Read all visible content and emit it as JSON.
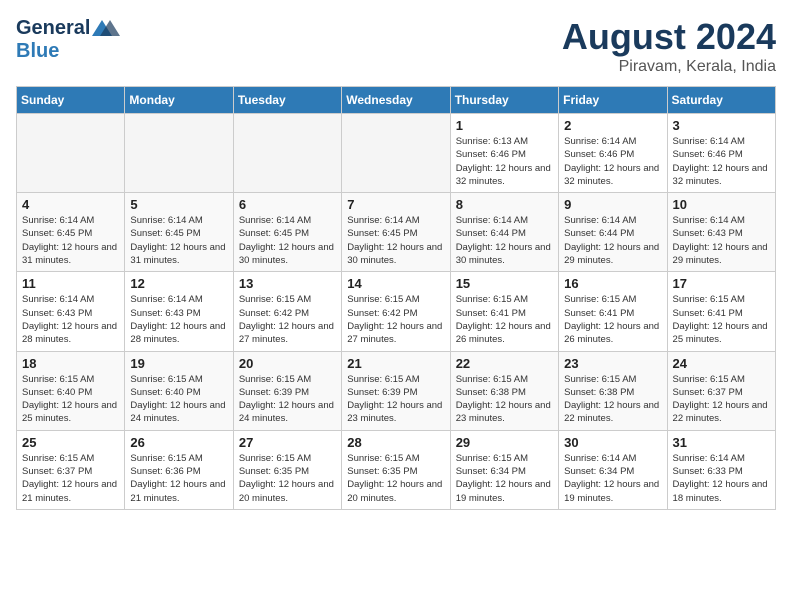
{
  "header": {
    "logo_general": "General",
    "logo_blue": "Blue",
    "month_title": "August 2024",
    "location": "Piravam, Kerala, India"
  },
  "calendar": {
    "days_of_week": [
      "Sunday",
      "Monday",
      "Tuesday",
      "Wednesday",
      "Thursday",
      "Friday",
      "Saturday"
    ],
    "weeks": [
      {
        "days": [
          {
            "num": "",
            "empty": true
          },
          {
            "num": "",
            "empty": true
          },
          {
            "num": "",
            "empty": true
          },
          {
            "num": "",
            "empty": true
          },
          {
            "num": "1",
            "sunrise": "6:13 AM",
            "sunset": "6:46 PM",
            "daylight": "12 hours and 32 minutes."
          },
          {
            "num": "2",
            "sunrise": "6:14 AM",
            "sunset": "6:46 PM",
            "daylight": "12 hours and 32 minutes."
          },
          {
            "num": "3",
            "sunrise": "6:14 AM",
            "sunset": "6:46 PM",
            "daylight": "12 hours and 32 minutes."
          }
        ]
      },
      {
        "days": [
          {
            "num": "4",
            "sunrise": "6:14 AM",
            "sunset": "6:45 PM",
            "daylight": "12 hours and 31 minutes."
          },
          {
            "num": "5",
            "sunrise": "6:14 AM",
            "sunset": "6:45 PM",
            "daylight": "12 hours and 31 minutes."
          },
          {
            "num": "6",
            "sunrise": "6:14 AM",
            "sunset": "6:45 PM",
            "daylight": "12 hours and 30 minutes."
          },
          {
            "num": "7",
            "sunrise": "6:14 AM",
            "sunset": "6:45 PM",
            "daylight": "12 hours and 30 minutes."
          },
          {
            "num": "8",
            "sunrise": "6:14 AM",
            "sunset": "6:44 PM",
            "daylight": "12 hours and 30 minutes."
          },
          {
            "num": "9",
            "sunrise": "6:14 AM",
            "sunset": "6:44 PM",
            "daylight": "12 hours and 29 minutes."
          },
          {
            "num": "10",
            "sunrise": "6:14 AM",
            "sunset": "6:43 PM",
            "daylight": "12 hours and 29 minutes."
          }
        ]
      },
      {
        "days": [
          {
            "num": "11",
            "sunrise": "6:14 AM",
            "sunset": "6:43 PM",
            "daylight": "12 hours and 28 minutes."
          },
          {
            "num": "12",
            "sunrise": "6:14 AM",
            "sunset": "6:43 PM",
            "daylight": "12 hours and 28 minutes."
          },
          {
            "num": "13",
            "sunrise": "6:15 AM",
            "sunset": "6:42 PM",
            "daylight": "12 hours and 27 minutes."
          },
          {
            "num": "14",
            "sunrise": "6:15 AM",
            "sunset": "6:42 PM",
            "daylight": "12 hours and 27 minutes."
          },
          {
            "num": "15",
            "sunrise": "6:15 AM",
            "sunset": "6:41 PM",
            "daylight": "12 hours and 26 minutes."
          },
          {
            "num": "16",
            "sunrise": "6:15 AM",
            "sunset": "6:41 PM",
            "daylight": "12 hours and 26 minutes."
          },
          {
            "num": "17",
            "sunrise": "6:15 AM",
            "sunset": "6:41 PM",
            "daylight": "12 hours and 25 minutes."
          }
        ]
      },
      {
        "days": [
          {
            "num": "18",
            "sunrise": "6:15 AM",
            "sunset": "6:40 PM",
            "daylight": "12 hours and 25 minutes."
          },
          {
            "num": "19",
            "sunrise": "6:15 AM",
            "sunset": "6:40 PM",
            "daylight": "12 hours and 24 minutes."
          },
          {
            "num": "20",
            "sunrise": "6:15 AM",
            "sunset": "6:39 PM",
            "daylight": "12 hours and 24 minutes."
          },
          {
            "num": "21",
            "sunrise": "6:15 AM",
            "sunset": "6:39 PM",
            "daylight": "12 hours and 23 minutes."
          },
          {
            "num": "22",
            "sunrise": "6:15 AM",
            "sunset": "6:38 PM",
            "daylight": "12 hours and 23 minutes."
          },
          {
            "num": "23",
            "sunrise": "6:15 AM",
            "sunset": "6:38 PM",
            "daylight": "12 hours and 22 minutes."
          },
          {
            "num": "24",
            "sunrise": "6:15 AM",
            "sunset": "6:37 PM",
            "daylight": "12 hours and 22 minutes."
          }
        ]
      },
      {
        "days": [
          {
            "num": "25",
            "sunrise": "6:15 AM",
            "sunset": "6:37 PM",
            "daylight": "12 hours and 21 minutes."
          },
          {
            "num": "26",
            "sunrise": "6:15 AM",
            "sunset": "6:36 PM",
            "daylight": "12 hours and 21 minutes."
          },
          {
            "num": "27",
            "sunrise": "6:15 AM",
            "sunset": "6:35 PM",
            "daylight": "12 hours and 20 minutes."
          },
          {
            "num": "28",
            "sunrise": "6:15 AM",
            "sunset": "6:35 PM",
            "daylight": "12 hours and 20 minutes."
          },
          {
            "num": "29",
            "sunrise": "6:15 AM",
            "sunset": "6:34 PM",
            "daylight": "12 hours and 19 minutes."
          },
          {
            "num": "30",
            "sunrise": "6:14 AM",
            "sunset": "6:34 PM",
            "daylight": "12 hours and 19 minutes."
          },
          {
            "num": "31",
            "sunrise": "6:14 AM",
            "sunset": "6:33 PM",
            "daylight": "12 hours and 18 minutes."
          }
        ]
      }
    ]
  }
}
